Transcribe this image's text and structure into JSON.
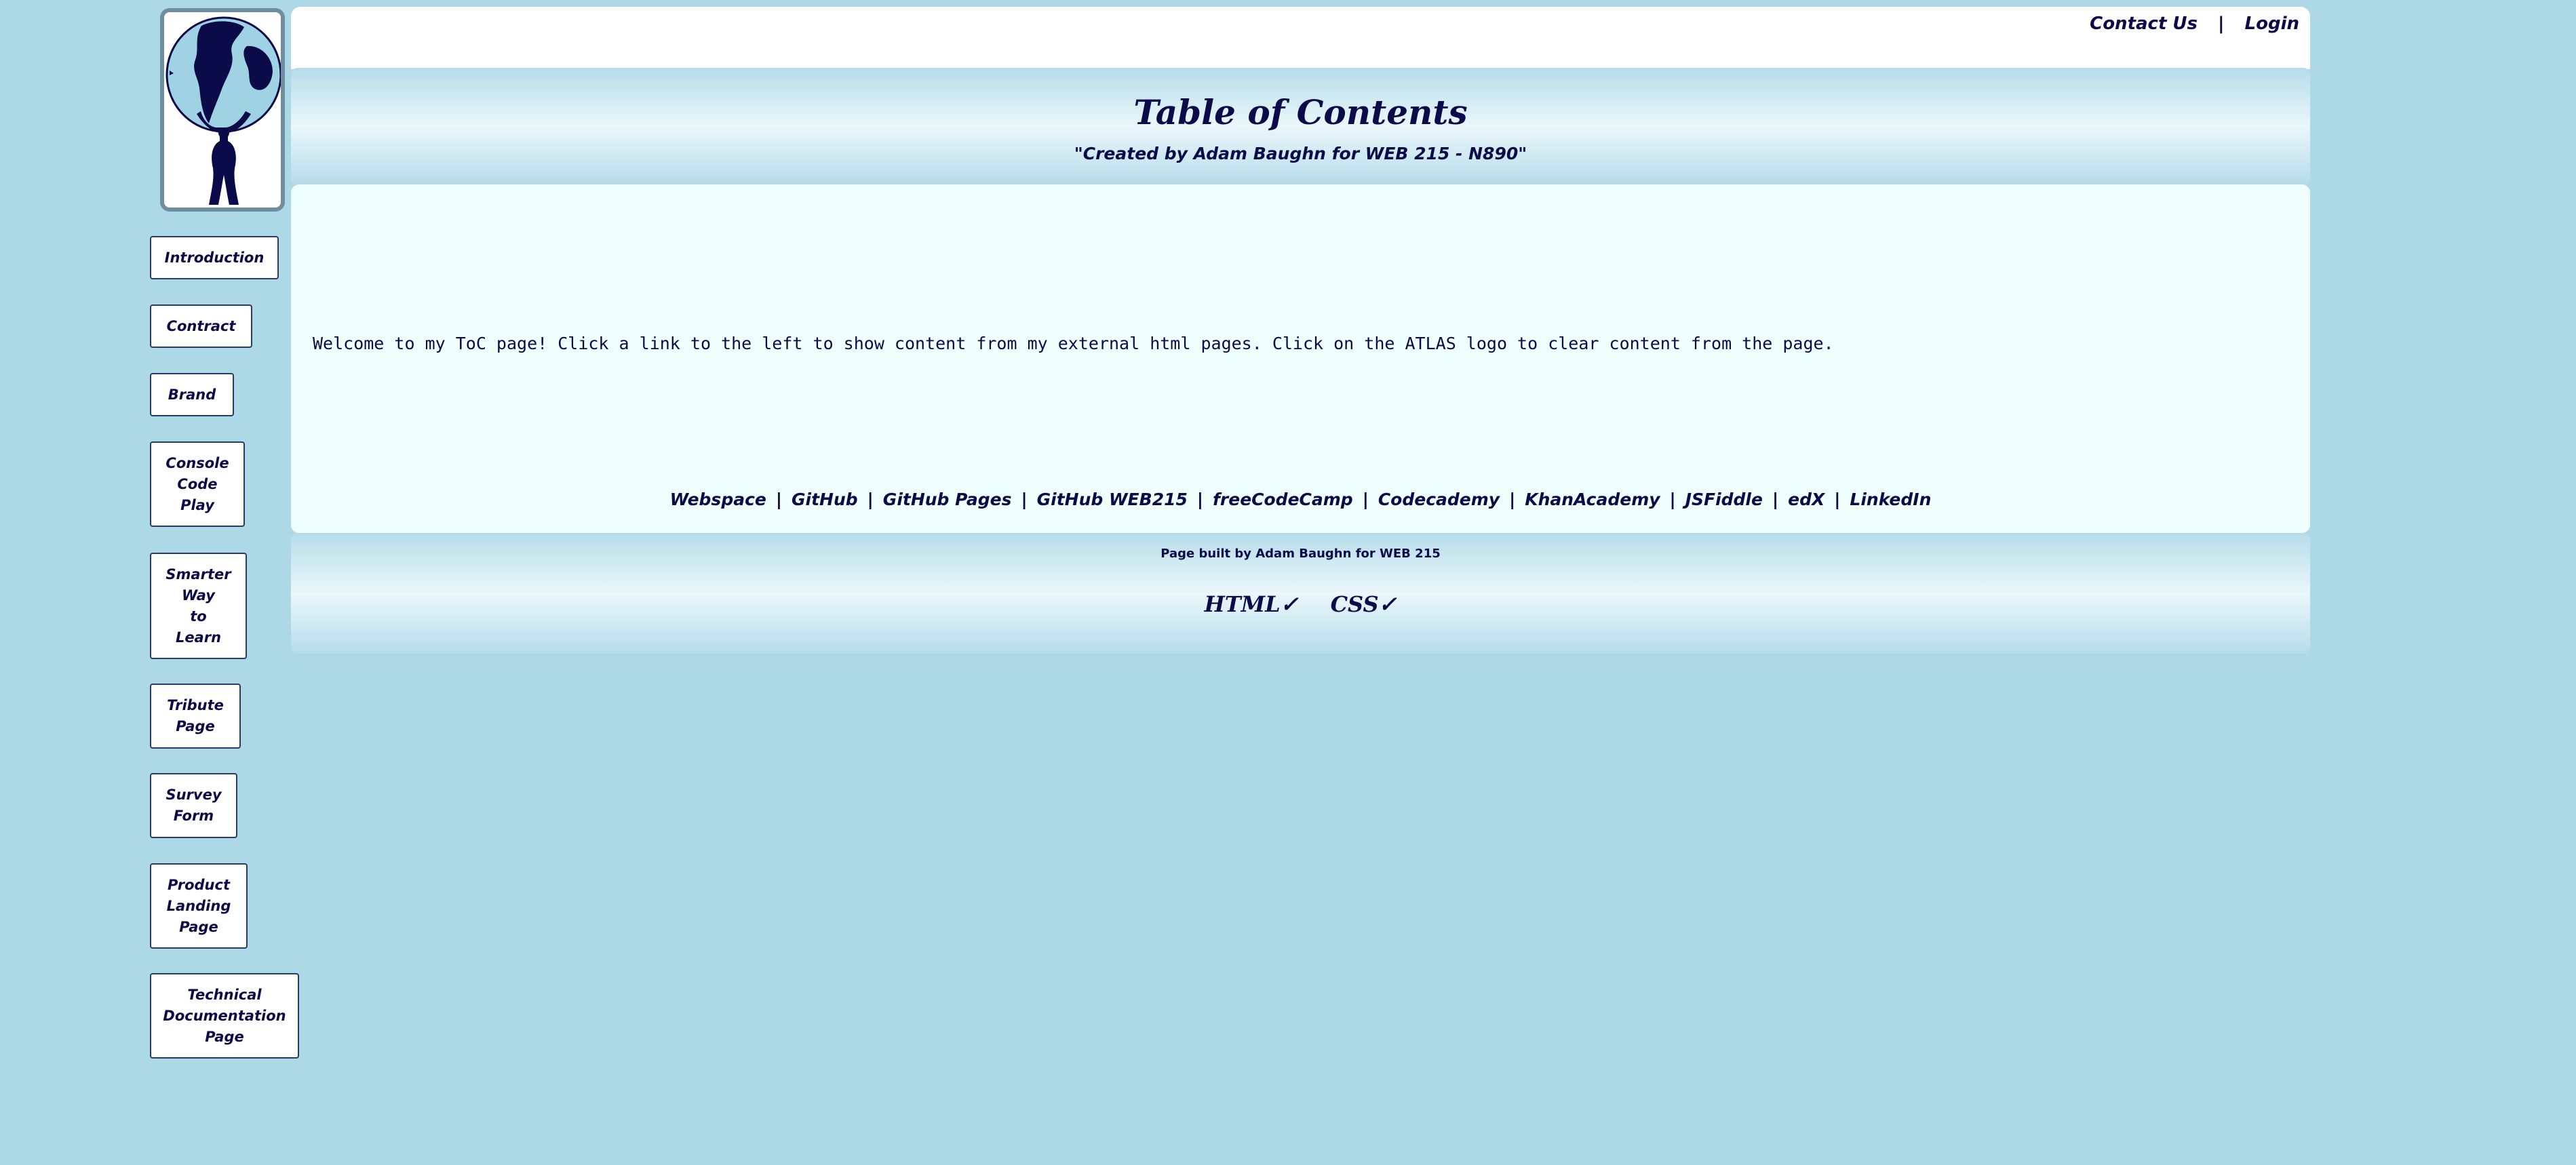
{
  "logo": {
    "icon": "atlas-globe-icon"
  },
  "nav": {
    "items": [
      {
        "label": "Introduction"
      },
      {
        "label": "Contract"
      },
      {
        "label": "Brand"
      },
      {
        "label": "Console\nCode\nPlay"
      },
      {
        "label": "Smarter\nWay\nto\nLearn"
      },
      {
        "label": "Tribute\nPage"
      },
      {
        "label": "Survey\nForm"
      },
      {
        "label": "Product\nLanding\nPage"
      },
      {
        "label": "Technical\nDocumentation\nPage"
      }
    ]
  },
  "topbar": {
    "contact": "Contact Us",
    "separator": "|",
    "login": "Login"
  },
  "header": {
    "title": "Table of Contents",
    "subtitle": "\"Created by Adam Baughn for WEB 215 - N890\""
  },
  "main": {
    "welcome": "Welcome to my ToC page! Click a link to the left to show content from my external html pages. Click on the ATLAS logo to clear content from the page."
  },
  "external_links": {
    "separator": "|",
    "items": [
      {
        "label": "Webspace"
      },
      {
        "label": "GitHub"
      },
      {
        "label": "GitHub Pages"
      },
      {
        "label": "GitHub WEB215"
      },
      {
        "label": "freeCodeCamp"
      },
      {
        "label": "Codecademy"
      },
      {
        "label": "KhanAcademy"
      },
      {
        "label": "JSFiddle"
      },
      {
        "label": "edX"
      },
      {
        "label": "LinkedIn"
      }
    ]
  },
  "footer": {
    "built_by": "Page built by Adam Baughn for WEB 215",
    "html_validator": "HTML✓",
    "css_validator": "CSS✓"
  },
  "colors": {
    "background": "#add8e6",
    "text": "#0b0b4a",
    "panel": "#effffe"
  }
}
